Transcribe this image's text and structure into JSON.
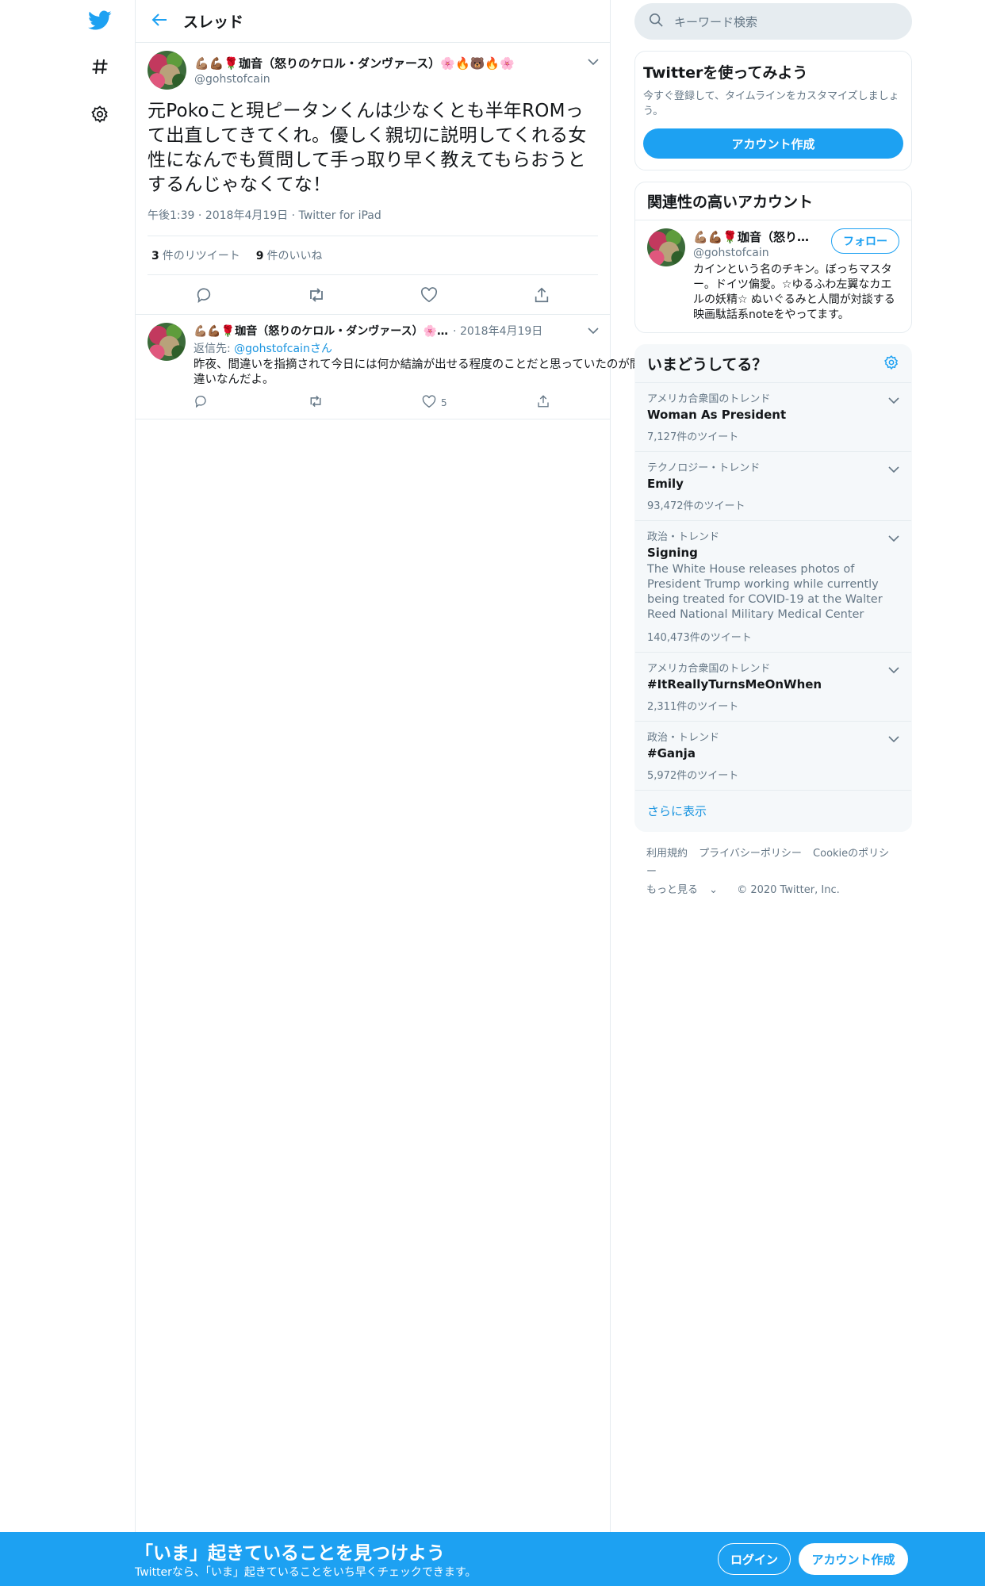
{
  "header": {
    "title": "スレッド"
  },
  "search": {
    "placeholder": "キーワード検索"
  },
  "focus_tweet": {
    "display_name": "💪🏽💪🏾🌹珈音（怒りのケロル・ダンヴァース）🌸🔥🐻🔥🌸",
    "screen_name": "@gohstofcain",
    "text": "元Pokoこと現ピータンくんは少なくとも半年ROMって出直してきてくれ。優しく親切に説明してくれる女性になんでも質問して手っ取り早く教えてもらおうとするんじゃなくてな！",
    "time": "午後1:39",
    "date": "2018年4月19日",
    "client": "Twitter for iPad",
    "retweet_count": "3",
    "retweet_label": "件のリツイート",
    "like_count": "9",
    "like_label": "件のいいね"
  },
  "reply_tweet": {
    "display_name": "💪🏽💪🏾🌹珈音（怒りのケロル・ダンヴァース）🌸…",
    "date": "2018年4月19日",
    "reply_to_prefix": "返信先: ",
    "reply_to_user": "@gohstofcain",
    "reply_to_suffix": "さん",
    "text": "昨夜、間違いを指摘されて今日には何か結論が出せる程度のことだと思っていたのが間違いなんだよ。",
    "like_count": "5"
  },
  "signup_card": {
    "title": "Twitterを使ってみよう",
    "description": "今すぐ登録して、タイムラインをカスタマイズしましょう。",
    "button": "アカウント作成"
  },
  "related": {
    "title": "関連性の高いアカウント",
    "display_name": "💪🏽💪🏾🌹珈音（怒り…",
    "screen_name": "@gohstofcain",
    "follow_label": "フォロー",
    "bio": "カインという名のチキン。ぼっちマスター。ドイツ偏愛。☆ゆるふわ左翼なカエルの妖精☆ ぬいぐるみと人間が対談する映画駄話系noteをやってます。"
  },
  "trends": {
    "title": "いまどうしてる？",
    "items": [
      {
        "context": "アメリカ合衆国のトレンド",
        "name": "Woman As President",
        "description": "",
        "count": "7,127件のツイート"
      },
      {
        "context": "テクノロジー・トレンド",
        "name": "Emily",
        "description": "",
        "count": "93,472件のツイート"
      },
      {
        "context": "政治・トレンド",
        "name": "Signing",
        "description": "The White House releases photos of President Trump working while currently being treated for COVID-19 at the Walter Reed National Military Medical Center",
        "count": "140,473件のツイート"
      },
      {
        "context": "アメリカ合衆国のトレンド",
        "name": "#ItReallyTurnsMeOnWhen",
        "description": "",
        "count": "2,311件のツイート"
      },
      {
        "context": "政治・トレンド",
        "name": "#Ganja",
        "description": "",
        "count": "5,972件のツイート"
      }
    ],
    "show_more": "さらに表示"
  },
  "footer": {
    "terms": "利用規約",
    "privacy": "プライバシーポリシー",
    "cookie": "Cookieのポリシー",
    "more": "もっと見る",
    "copyright": "© 2020 Twitter, Inc."
  },
  "bottom_bar": {
    "title": "「いま」起きていることを見つけよう",
    "subtitle": "Twitterなら、「いま」起きていることをいち早くチェックできます。",
    "login": "ログイン",
    "signup": "アカウント作成"
  },
  "colors": {
    "brand": "#1da1f2",
    "link": "#1b95e0",
    "secondary_text": "#657786",
    "border": "#e6ecf0"
  },
  "icons": [
    "twitter-logo-icon",
    "hashtag-icon",
    "gear-icon",
    "back-arrow-icon",
    "search-icon",
    "chevron-down-icon",
    "reply-icon",
    "retweet-icon",
    "like-icon",
    "share-icon"
  ]
}
